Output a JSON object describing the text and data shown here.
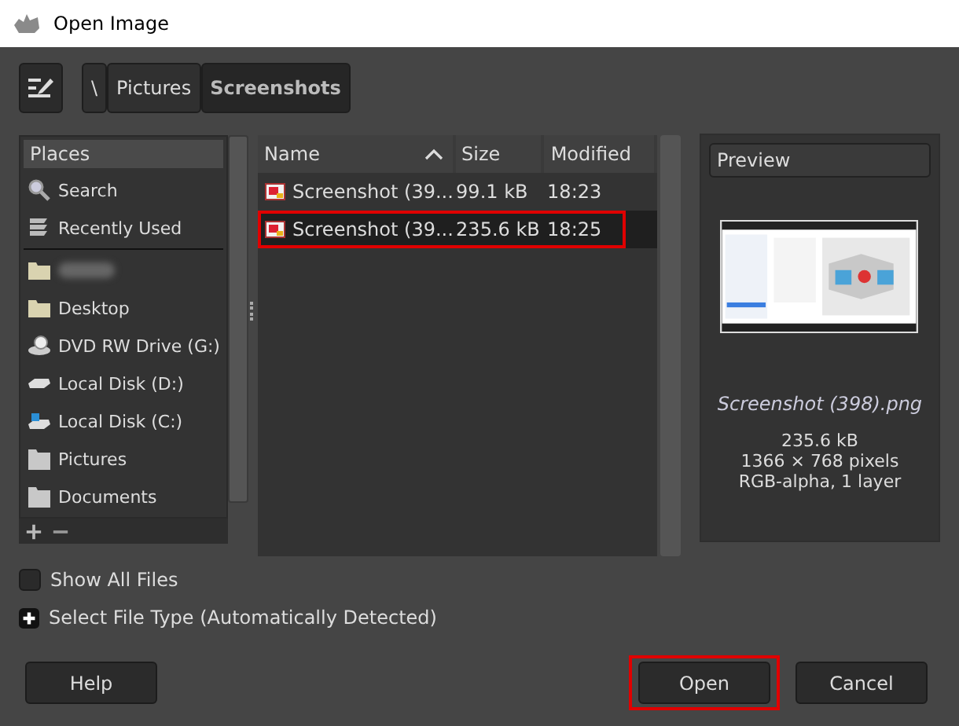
{
  "window": {
    "title": "Open Image"
  },
  "path_bar": {
    "buttons": [
      {
        "label": "\\",
        "selected": false
      },
      {
        "label": "Pictures",
        "selected": false
      },
      {
        "label": "Screenshots",
        "selected": true
      }
    ]
  },
  "places": {
    "title": "Places",
    "sections": [
      [
        {
          "kind": "search",
          "label": "Search"
        },
        {
          "kind": "recent",
          "label": "Recently Used"
        }
      ],
      [
        {
          "kind": "folder",
          "blurred": true
        },
        {
          "kind": "folder",
          "label": "Desktop"
        },
        {
          "kind": "dvd",
          "label": "DVD RW Drive (G:)"
        },
        {
          "kind": "disk",
          "label": "Local Disk (D:)"
        },
        {
          "kind": "system-disk",
          "label": "Local Disk (C:)"
        },
        {
          "kind": "gray-folder",
          "label": "Pictures"
        },
        {
          "kind": "gray-folder",
          "label": "Documents"
        }
      ]
    ]
  },
  "files": {
    "columns": [
      {
        "label": "Name",
        "sorted_ascending": true
      },
      {
        "label": "Size"
      },
      {
        "label": "Modified"
      }
    ],
    "rows": [
      {
        "name": "Screenshot (39...",
        "size": "99.1 kB",
        "modified": "18:23",
        "selected": false,
        "highlighted": false
      },
      {
        "name": "Screenshot (39...",
        "size": "235.6 kB",
        "modified": "18:25",
        "selected": true,
        "highlighted": true
      }
    ]
  },
  "preview": {
    "title": "Preview",
    "filename": "Screenshot (398).png",
    "info": [
      "235.6 kB",
      "1366 × 768 pixels",
      "RGB-alpha, 1 layer"
    ]
  },
  "options": [
    {
      "kind": "checkbox",
      "label": "Show All Files",
      "checked": false
    },
    {
      "kind": "expander",
      "label": "Select File Type (Automatically Detected)",
      "expanded": false
    }
  ],
  "buttons": [
    {
      "label": "Help",
      "highlighted": false
    },
    {
      "label": "Open",
      "highlighted": true
    },
    {
      "label": "Cancel",
      "highlighted": false
    }
  ]
}
